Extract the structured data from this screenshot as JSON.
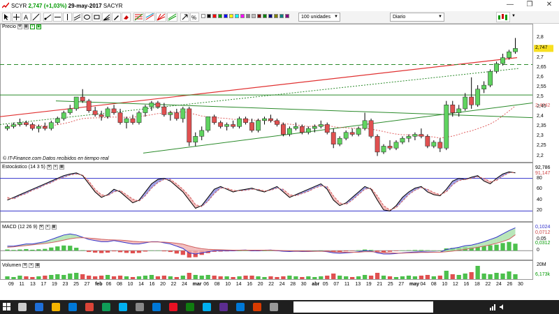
{
  "window": {
    "symbol": "SCYR",
    "price_change": "2,747 (+1,03%)",
    "date": "29-may-2017",
    "name": "SACYR",
    "minimize": "—",
    "maximize": "❐",
    "close": "✕"
  },
  "toolbar": {
    "units_select": "100 unidades",
    "period_select": "Diario",
    "swatch_colors": [
      "#ffffff",
      "#000000",
      "#ff0000",
      "#00a000",
      "#0000ff",
      "#ffff00",
      "#00ffff",
      "#ff00ff",
      "#808080",
      "#c0c0c0",
      "#800000",
      "#008000",
      "#000080",
      "#808000",
      "#008080",
      "#800080",
      "#ff8000",
      "#ffffff"
    ]
  },
  "panels": {
    "price": {
      "label": "Precio"
    },
    "stochastic": {
      "label": "Estocástico (14 3 5)",
      "value1": "92,786",
      "value2": "91,147"
    },
    "macd": {
      "label": "MACD (12 26 9)",
      "value1": "0,1024",
      "value2": "0,0712",
      "value3": "0,0312"
    },
    "volume": {
      "label": "Volumen",
      "value1": "6,173k"
    }
  },
  "watermark": "© IT-Finance.com  Datos recibidos en tiempo real",
  "price_axis": {
    "ticks": [
      "2,8",
      "2,7",
      "2,65",
      "2,6",
      "2,55",
      "2,5",
      "2,45",
      "2,4",
      "2,35",
      "2,3",
      "2,25",
      "2,2"
    ],
    "current_price": "2,747",
    "marker_price": "2,4742"
  },
  "stoch_axis": {
    "ticks": [
      "80",
      "60",
      "40",
      "20"
    ]
  },
  "macd_axis": {
    "ticks": [
      "0.05",
      "0"
    ]
  },
  "volume_axis": {
    "ticks": [
      "20M"
    ]
  },
  "x_axis": {
    "labels": [
      "09",
      "11",
      "13",
      "17",
      "19",
      "23",
      "25",
      "27",
      "feb",
      "06",
      "08",
      "10",
      "14",
      "16",
      "20",
      "22",
      "24",
      "mar",
      "06",
      "08",
      "10",
      "14",
      "16",
      "20",
      "22",
      "24",
      "28",
      "30",
      "abr",
      "05",
      "07",
      "11",
      "13",
      "19",
      "21",
      "25",
      "27",
      "may",
      "04",
      "08",
      "10",
      "12",
      "16",
      "18",
      "22",
      "24",
      "26",
      "30"
    ]
  },
  "chart_data": {
    "type": "candlestick",
    "title": "SCYR 2,747 (+1,03%) 29-may-2017 SACYR",
    "ylim": [
      2.17,
      2.83
    ],
    "candles": [
      [
        2.34,
        2.36,
        2.33,
        2.35
      ],
      [
        2.35,
        2.37,
        2.34,
        2.36
      ],
      [
        2.36,
        2.39,
        2.35,
        2.37
      ],
      [
        2.37,
        2.38,
        2.35,
        2.36
      ],
      [
        2.36,
        2.37,
        2.33,
        2.34
      ],
      [
        2.34,
        2.36,
        2.32,
        2.35
      ],
      [
        2.35,
        2.37,
        2.33,
        2.34
      ],
      [
        2.34,
        2.38,
        2.33,
        2.37
      ],
      [
        2.37,
        2.4,
        2.36,
        2.39
      ],
      [
        2.39,
        2.43,
        2.38,
        2.42
      ],
      [
        2.42,
        2.46,
        2.41,
        2.44
      ],
      [
        2.44,
        2.5,
        2.43,
        2.5
      ],
      [
        2.5,
        2.54,
        2.47,
        2.48
      ],
      [
        2.48,
        2.49,
        2.42,
        2.43
      ],
      [
        2.43,
        2.45,
        2.4,
        2.41
      ],
      [
        2.41,
        2.43,
        2.38,
        2.4
      ],
      [
        2.4,
        2.45,
        2.39,
        2.44
      ],
      [
        2.44,
        2.46,
        2.41,
        2.42
      ],
      [
        2.42,
        2.44,
        2.36,
        2.37
      ],
      [
        2.37,
        2.4,
        2.34,
        2.39
      ],
      [
        2.39,
        2.41,
        2.36,
        2.37
      ],
      [
        2.37,
        2.43,
        2.36,
        2.42
      ],
      [
        2.42,
        2.46,
        2.4,
        2.45
      ],
      [
        2.45,
        2.48,
        2.43,
        2.47
      ],
      [
        2.47,
        2.48,
        2.44,
        2.45
      ],
      [
        2.45,
        2.47,
        2.4,
        2.41
      ],
      [
        2.41,
        2.43,
        2.38,
        2.42
      ],
      [
        2.42,
        2.44,
        2.38,
        2.39
      ],
      [
        2.39,
        2.45,
        2.37,
        2.44
      ],
      [
        2.44,
        2.45,
        2.25,
        2.27
      ],
      [
        2.27,
        2.32,
        2.25,
        2.3
      ],
      [
        2.3,
        2.35,
        2.28,
        2.33
      ],
      [
        2.33,
        2.4,
        2.32,
        2.4
      ],
      [
        2.4,
        2.41,
        2.36,
        2.37
      ],
      [
        2.37,
        2.38,
        2.34,
        2.35
      ],
      [
        2.35,
        2.37,
        2.33,
        2.36
      ],
      [
        2.36,
        2.38,
        2.34,
        2.35
      ],
      [
        2.35,
        2.4,
        2.34,
        2.39
      ],
      [
        2.39,
        2.4,
        2.36,
        2.37
      ],
      [
        2.37,
        2.39,
        2.32,
        2.33
      ],
      [
        2.33,
        2.39,
        2.32,
        2.38
      ],
      [
        2.38,
        2.4,
        2.36,
        2.39
      ],
      [
        2.39,
        2.41,
        2.37,
        2.38
      ],
      [
        2.38,
        2.39,
        2.35,
        2.36
      ],
      [
        2.36,
        2.37,
        2.3,
        2.31
      ],
      [
        2.31,
        2.35,
        2.3,
        2.34
      ],
      [
        2.34,
        2.37,
        2.33,
        2.35
      ],
      [
        2.35,
        2.36,
        2.31,
        2.32
      ],
      [
        2.32,
        2.35,
        2.31,
        2.34
      ],
      [
        2.34,
        2.36,
        2.32,
        2.35
      ],
      [
        2.35,
        2.38,
        2.34,
        2.36
      ],
      [
        2.36,
        2.37,
        2.31,
        2.32
      ],
      [
        2.32,
        2.34,
        2.24,
        2.26
      ],
      [
        2.26,
        2.3,
        2.25,
        2.29
      ],
      [
        2.29,
        2.33,
        2.28,
        2.32
      ],
      [
        2.32,
        2.34,
        2.3,
        2.31
      ],
      [
        2.31,
        2.35,
        2.3,
        2.34
      ],
      [
        2.34,
        2.42,
        2.33,
        2.38
      ],
      [
        2.38,
        2.39,
        2.29,
        2.3
      ],
      [
        2.3,
        2.31,
        2.2,
        2.22
      ],
      [
        2.22,
        2.26,
        2.21,
        2.25
      ],
      [
        2.25,
        2.28,
        2.23,
        2.24
      ],
      [
        2.24,
        2.28,
        2.23,
        2.27
      ],
      [
        2.27,
        2.3,
        2.26,
        2.29
      ],
      [
        2.29,
        2.31,
        2.27,
        2.3
      ],
      [
        2.3,
        2.32,
        2.28,
        2.31
      ],
      [
        2.31,
        2.34,
        2.29,
        2.3
      ],
      [
        2.3,
        2.31,
        2.24,
        2.25
      ],
      [
        2.25,
        2.28,
        2.24,
        2.27
      ],
      [
        2.27,
        2.29,
        2.22,
        2.24
      ],
      [
        2.24,
        2.48,
        2.23,
        2.46
      ],
      [
        2.46,
        2.48,
        2.4,
        2.42
      ],
      [
        2.42,
        2.46,
        2.4,
        2.44
      ],
      [
        2.44,
        2.52,
        2.43,
        2.5
      ],
      [
        2.5,
        2.6,
        2.44,
        2.46
      ],
      [
        2.46,
        2.56,
        2.45,
        2.54
      ],
      [
        2.54,
        2.58,
        2.52,
        2.56
      ],
      [
        2.56,
        2.64,
        2.55,
        2.63
      ],
      [
        2.63,
        2.68,
        2.62,
        2.67
      ],
      [
        2.67,
        2.72,
        2.66,
        2.7
      ],
      [
        2.7,
        2.74,
        2.69,
        2.73
      ],
      [
        2.73,
        2.8,
        2.72,
        2.747
      ]
    ],
    "stochastic_k": [
      40,
      45,
      50,
      55,
      60,
      65,
      70,
      75,
      80,
      85,
      88,
      90,
      85,
      70,
      55,
      45,
      50,
      60,
      55,
      45,
      35,
      40,
      55,
      70,
      78,
      80,
      75,
      65,
      55,
      40,
      25,
      30,
      45,
      60,
      65,
      60,
      55,
      58,
      60,
      62,
      58,
      55,
      60,
      65,
      55,
      45,
      50,
      55,
      60,
      65,
      70,
      60,
      40,
      30,
      35,
      45,
      55,
      65,
      60,
      40,
      22,
      20,
      30,
      45,
      55,
      62,
      65,
      55,
      50,
      48,
      60,
      75,
      80,
      78,
      82,
      85,
      75,
      70,
      80,
      88,
      92,
      90
    ],
    "stochastic_d": [
      45,
      42,
      48,
      52,
      58,
      62,
      68,
      72,
      78,
      82,
      86,
      88,
      86,
      75,
      60,
      50,
      48,
      55,
      58,
      50,
      42,
      38,
      48,
      62,
      72,
      78,
      78,
      70,
      60,
      48,
      32,
      28,
      38,
      52,
      62,
      62,
      58,
      57,
      58,
      60,
      60,
      57,
      58,
      62,
      60,
      50,
      48,
      52,
      56,
      62,
      66,
      65,
      48,
      35,
      32,
      40,
      50,
      60,
      62,
      48,
      30,
      22,
      26,
      38,
      50,
      58,
      63,
      60,
      54,
      50,
      55,
      68,
      76,
      78,
      80,
      83,
      80,
      74,
      76,
      84,
      90,
      91
    ],
    "macd": [
      0.02,
      0.02,
      0.025,
      0.03,
      0.03,
      0.035,
      0.04,
      0.05,
      0.06,
      0.07,
      0.075,
      0.07,
      0.06,
      0.05,
      0.045,
      0.04,
      0.04,
      0.045,
      0.04,
      0.035,
      0.03,
      0.03,
      0.035,
      0.04,
      0.04,
      0.035,
      0.03,
      0.02,
      0.01,
      -0.01,
      -0.015,
      -0.01,
      -0.005,
      0,
      0,
      0,
      0,
      0.002,
      0.003,
      0,
      0,
      0.002,
      0.003,
      0,
      -0.003,
      -0.004,
      -0.003,
      -0.004,
      -0.004,
      -0.003,
      -0.002,
      -0.005,
      -0.01,
      -0.012,
      -0.01,
      -0.008,
      -0.005,
      0,
      -0.002,
      -0.01,
      -0.015,
      -0.015,
      -0.013,
      -0.01,
      -0.008,
      -0.006,
      -0.005,
      -0.006,
      -0.006,
      -0.007,
      0.005,
      0.01,
      0.015,
      0.022,
      0.025,
      0.032,
      0.04,
      0.05,
      0.06,
      0.075,
      0.09,
      0.1024
    ],
    "macd_signal": [
      0.015,
      0.017,
      0.02,
      0.023,
      0.026,
      0.029,
      0.032,
      0.036,
      0.041,
      0.047,
      0.053,
      0.057,
      0.058,
      0.056,
      0.054,
      0.051,
      0.049,
      0.048,
      0.047,
      0.045,
      0.042,
      0.04,
      0.039,
      0.039,
      0.039,
      0.038,
      0.036,
      0.033,
      0.029,
      0.021,
      0.014,
      0.009,
      0.006,
      0.005,
      0.004,
      0.003,
      0.002,
      0.002,
      0.002,
      0.002,
      0.002,
      0.002,
      0.002,
      0.001,
      0,
      -0.001,
      -0.002,
      -0.002,
      -0.003,
      -0.003,
      -0.003,
      -0.003,
      -0.005,
      -0.006,
      -0.007,
      -0.007,
      -0.007,
      -0.005,
      -0.005,
      -0.006,
      -0.008,
      -0.01,
      -0.011,
      -0.011,
      -0.01,
      -0.009,
      -0.008,
      -0.008,
      -0.007,
      -0.007,
      -0.005,
      -0.002,
      0.002,
      0.006,
      0.01,
      0.015,
      0.02,
      0.026,
      0.033,
      0.041,
      0.051,
      0.0712
    ],
    "macd_hist": [
      0.005,
      0.003,
      0.005,
      0.007,
      0.004,
      0.006,
      0.008,
      0.014,
      0.019,
      0.023,
      0.022,
      0.013,
      0.002,
      -0.006,
      -0.009,
      -0.011,
      -0.009,
      -0.003,
      -0.007,
      -0.01,
      -0.012,
      -0.01,
      -0.004,
      0.001,
      0.001,
      -0.003,
      -0.006,
      -0.013,
      -0.019,
      -0.031,
      -0.029,
      -0.019,
      -0.011,
      -0.005,
      -0.004,
      -0.003,
      -0.002,
      0,
      0.001,
      -0.002,
      -0.002,
      0,
      0.001,
      -0.001,
      -0.003,
      -0.003,
      -0.001,
      -0.002,
      -0.001,
      0,
      0.001,
      -0.002,
      -0.005,
      -0.006,
      -0.003,
      -0.001,
      0.002,
      0.005,
      0.003,
      -0.004,
      -0.007,
      -0.005,
      -0.002,
      0.001,
      0.002,
      0.003,
      0.003,
      0.002,
      0.001,
      0,
      0.01,
      0.012,
      0.013,
      0.016,
      0.015,
      0.017,
      0.02,
      0.024,
      0.027,
      0.034,
      0.039,
      0.0312
    ],
    "volume": [
      4,
      3,
      5,
      4,
      3,
      4,
      5,
      6,
      7,
      6,
      8,
      9,
      7,
      5,
      4,
      5,
      6,
      4,
      5,
      4,
      3,
      4,
      5,
      6,
      4,
      5,
      4,
      3,
      5,
      9,
      6,
      5,
      6,
      5,
      4,
      4,
      3,
      4,
      5,
      5,
      4,
      3,
      4,
      3,
      4,
      5,
      4,
      3,
      4,
      3,
      4,
      5,
      8,
      5,
      4,
      3,
      4,
      6,
      5,
      9,
      5,
      4,
      3,
      4,
      5,
      4,
      5,
      6,
      4,
      5,
      12,
      7,
      6,
      8,
      10,
      19,
      8,
      7,
      9,
      8,
      11,
      7
    ]
  }
}
